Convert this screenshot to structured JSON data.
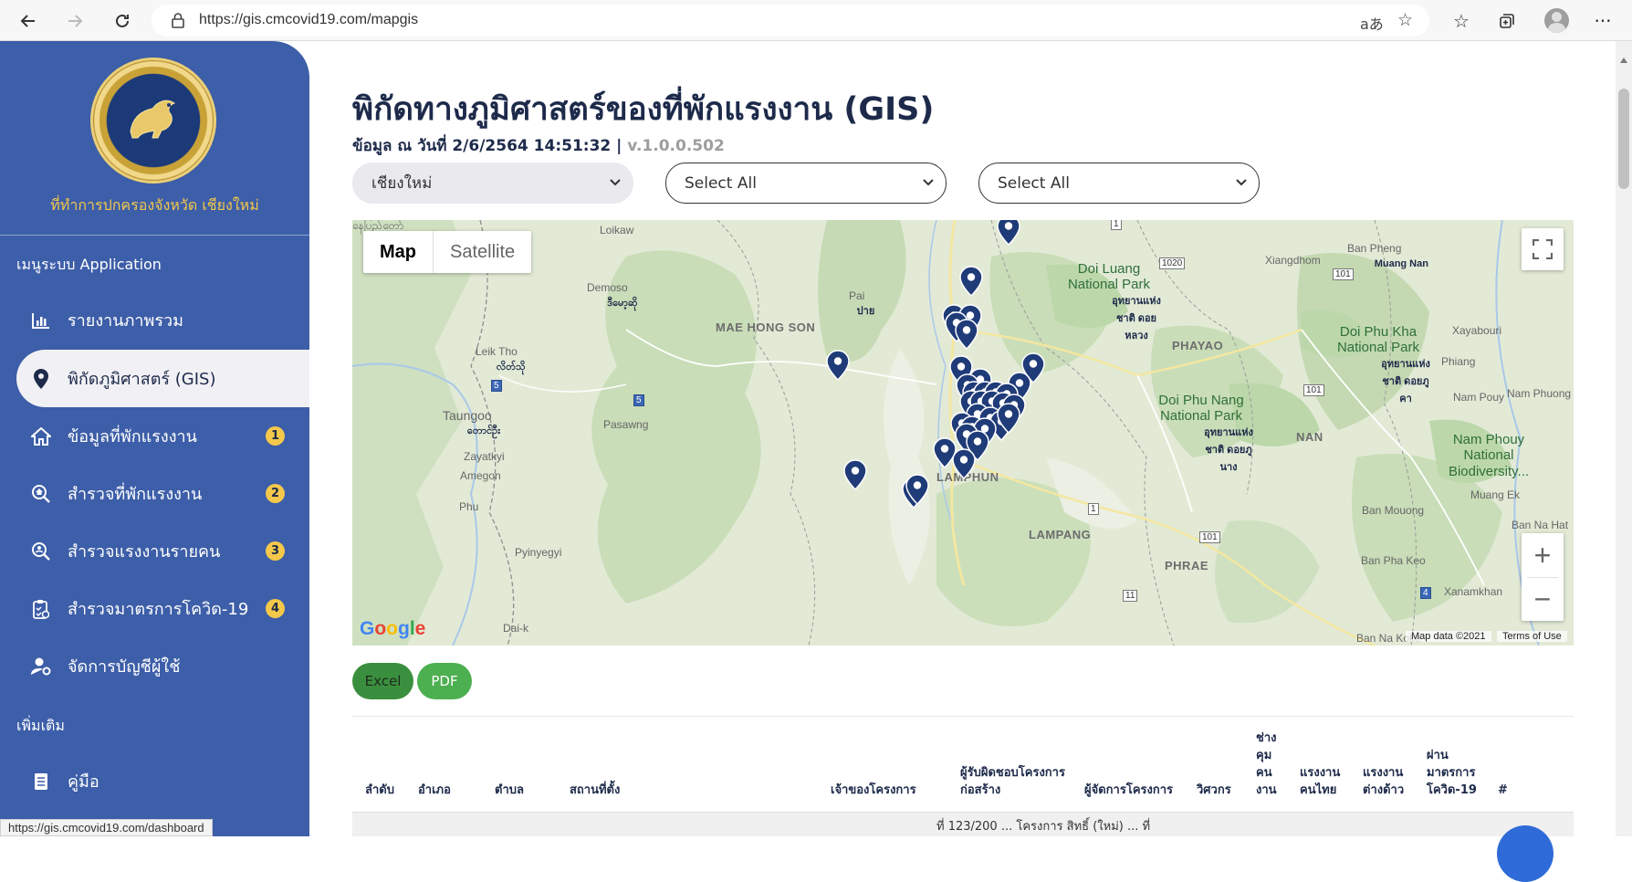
{
  "browser": {
    "url": "https://gis.cmcovid19.com/mapgis",
    "status_url": "https://gis.cmcovid19.com/dashboard"
  },
  "sidebar": {
    "org_name": "ที่ทำการปกครองจังหวัด เชียงใหม่",
    "section_app": "เมนูระบบ Application",
    "section_more": "เพิ่มเติม",
    "items": [
      {
        "label": "รายงานภาพรวม",
        "icon": "chart-icon"
      },
      {
        "label": "พิกัดภูมิศาสตร์ (GIS)",
        "icon": "map-pin-icon",
        "active": true
      },
      {
        "label": "ข้อมูลที่พักแรงงาน",
        "icon": "home-icon",
        "badge": "1"
      },
      {
        "label": "สำรวจที่พักแรงงาน",
        "icon": "search-home-icon",
        "badge": "2"
      },
      {
        "label": "สำรวจแรงงานรายคน",
        "icon": "search-person-icon",
        "badge": "3"
      },
      {
        "label": "สำรวจมาตรการโควิด-19",
        "icon": "checklist-icon",
        "badge": "4"
      },
      {
        "label": "จัดการบัญชีผู้ใช้",
        "icon": "user-settings-icon"
      }
    ],
    "manual_label": "คู่มือ"
  },
  "main": {
    "title": "พิกัดทางภูมิศาสตร์ของที่พักแรงงาน (GIS)",
    "subtitle": "ข้อมูล ณ วันที่ 2/6/2564 14:51:32 | ",
    "version": "v.1.0.0.502",
    "filters": {
      "province": "เชียงใหม่",
      "district": "Select All",
      "subdistrict": "Select All"
    }
  },
  "map": {
    "toggle_map": "Map",
    "toggle_satellite": "Satellite",
    "zoom_in": "+",
    "zoom_out": "−",
    "google": "Google",
    "credit": "Map data ©2021",
    "terms": "Terms of Use",
    "labels": {
      "mae_hong_son": "MAE HONG SON",
      "lamphun": "LAMPHUN",
      "lampang": "LAMPANG",
      "phayao": "PHAYAO",
      "phrae": "PHRAE",
      "nan": "NAN",
      "doi_luang": "Doi Luang National Park",
      "doi_luang_th": "อุทยานแห่งชาติ ดอยหลวง",
      "doi_phu_nang": "Doi Phu Nang National Park",
      "doi_phu_nang_th": "อุทยานแห่งชาติ ดอยภูนาง",
      "doi_phu_kha": "Doi Phu Kha National Park",
      "doi_phu_kha_th": "อุทยานแห่งชาติ ดอยภูคา",
      "nam_phouy": "Nam Phouy National Biodiversity...",
      "pai": "Pai",
      "pai_th": "ปาย",
      "taungoo": "Taungoo",
      "taungoo_mm": "တောင်ဦး",
      "leik_tho": "Leik Tho",
      "leik_tho_mm": "လိတ်သို",
      "zayatkyi": "Zayatkyi",
      "amegon": "Amegon",
      "phu": "Phu",
      "pasawng": "Pasawng",
      "demoso": "Demoso",
      "demoso_mm": "ဒီမော့ဆို",
      "loikaw": "Loikaw",
      "pyinyegyi": "Pyinyegyi",
      "dai_k": "Dai-k",
      "xiangdhom": "Xiangdhom",
      "ban_pheng": "Ban Pheng",
      "ban_pheng_th": "Muang Nan",
      "xayabouri": "Xayabouri",
      "phiang": "Phiang",
      "nam_pouy": "Nam Pouy",
      "nam_phuong": "Nam Phuong",
      "ban_muang": "Ban Mouong",
      "muang_ek": "Muang Ek",
      "ban_na_hat": "Ban Na Hat",
      "ban_pha_keo": "Ban Pha Keo",
      "xanamkhan": "Xanamkhan",
      "ban_na_koke": "Ban Na Koke",
      "myanmar_top": "နေပြည်တော်"
    },
    "roads": [
      "1",
      "1020",
      "101",
      "101",
      "5",
      "5",
      "1",
      "101",
      "11",
      "4"
    ]
  },
  "export": {
    "excel": "Excel",
    "pdf": "PDF"
  },
  "table": {
    "headers": {
      "no": "ลำดับ",
      "district": "อำเภอ",
      "subdistrict": "ตำบล",
      "location": "สถานที่ตั้ง",
      "owner": "เจ้าของโครงการ",
      "contractor": "ผู้รับผิดชอบโครงการก่อสร้าง",
      "manager": "ผู้จัดการโครงการ",
      "engineer": "วิศวกร",
      "foreman": "ช่างคุมคนงาน",
      "thai_labor": "แรงงานคนไทย",
      "foreign_labor": "แรงงานต่างด้าว",
      "passed": "ผ่านมาตรการโควิด-19",
      "hash": "#"
    },
    "header_lines": {
      "contractor_1": "ผู้รับผิดชอบโครงการ",
      "contractor_2": "ก่อสร้าง",
      "foreman_1": "ช่าง",
      "foreman_2": "คุม",
      "foreman_3": "คน",
      "foreman_4": "งาน",
      "thai_1": "แรงงาน",
      "thai_2": "คนไทย",
      "foreign_1": "แรงงาน",
      "foreign_2": "ต่างด้าว",
      "passed_1": "ผ่าน",
      "passed_2": "มาตรการ",
      "passed_3": "โควิด-19"
    },
    "first_row_partial": "ที่ 123/200 ... โครงการ สิทธิ์ (ใหม่) ... ที่"
  }
}
